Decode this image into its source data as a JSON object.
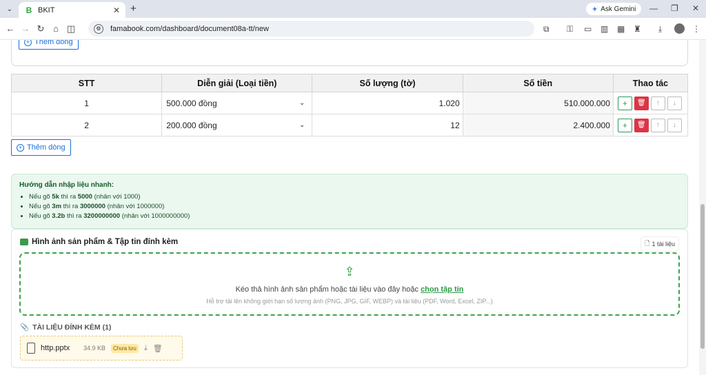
{
  "browser": {
    "tab_title": "BKIT",
    "favicon": "B",
    "url": "famabook.com/dashboard/document08a-tt/new",
    "gemini_label": "Ask Gemini"
  },
  "top_card": {
    "add_row_label": "Thêm dòng"
  },
  "table": {
    "headers": [
      "STT",
      "Diễn giải (Loại tiền)",
      "Số lượng (tờ)",
      "Số tiền",
      "Thao tác"
    ],
    "rows": [
      {
        "stt": "1",
        "desc": "500.000 đồng",
        "qty": "1.020",
        "amount": "510.000.000"
      },
      {
        "stt": "2",
        "desc": "200.000 đồng",
        "qty": "12",
        "amount": "2.400.000"
      }
    ],
    "add_row_label": "Thêm dòng"
  },
  "guide": {
    "title": "Hướng dẫn nhập liệu nhanh:",
    "items": [
      {
        "pre": "Nếu gõ ",
        "key": "5k",
        "mid": " thì ra ",
        "val": "5000",
        "post": " (nhân với 1000)"
      },
      {
        "pre": "Nếu gõ ",
        "key": "3m",
        "mid": " thì ra ",
        "val": "3000000",
        "post": " (nhân với 1000000)"
      },
      {
        "pre": "Nếu gõ ",
        "key": "3.2b",
        "mid": " thì ra ",
        "val": "3200000000",
        "post": " (nhân với 1000000000)"
      }
    ]
  },
  "attachments": {
    "title": "Hình ảnh sản phẩm & Tập tin đính kèm",
    "count_label": "1 tài liệu",
    "drop_text": "Kéo thả hình ảnh sản phẩm hoặc tài liệu vào đây hoặc ",
    "drop_link": "chọn tập tin",
    "drop_sub": "Hỗ trợ tải lên không giới hạn số lượng ảnh (PNG, JPG, GIF, WEBP) và tài liệu (PDF, Word, Excel, ZIP...)",
    "list_title": "TÀI LIỆU ĐÍNH KÈM (1)",
    "files": [
      {
        "name": "http.pptx",
        "size": "34.9 KB",
        "status": "Chưa lưu"
      }
    ]
  }
}
